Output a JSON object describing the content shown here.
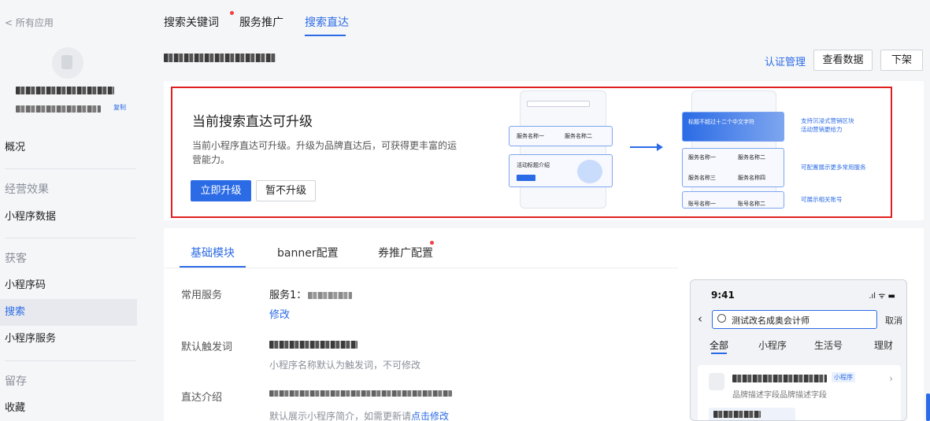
{
  "sidebar": {
    "back": "< 所有应用",
    "app_id_tag": "复制",
    "items": [
      {
        "label": "概况"
      },
      {
        "label": "经营效果"
      },
      {
        "label": "小程序数据"
      },
      {
        "label": "获客"
      },
      {
        "label": "小程序码"
      },
      {
        "label": "搜索"
      },
      {
        "label": "小程序服务"
      },
      {
        "label": "留存"
      },
      {
        "label": "收藏"
      }
    ]
  },
  "topnav": {
    "tabs": [
      "搜索关键词",
      "服务推广",
      "搜索直达"
    ],
    "active": "搜索直达"
  },
  "header": {
    "cert_link": "认证管理",
    "view_data": "查看数据",
    "offline": "下架"
  },
  "upgrade": {
    "title": "当前搜索直达可升级",
    "desc": "当前小程序直达可升级。升级为品牌直达后，可获得更丰富的运营能力。",
    "primary": "立即升级",
    "secondary": "暂不升级",
    "illustration": {
      "left_card_title1": "服务名称一",
      "left_card_title2": "服务名称二",
      "left_promo": "活动标题介绍",
      "right_banner": "标题不超过十二个中文字符",
      "right_services": [
        "服务名称一",
        "服务名称二",
        "服务名称三",
        "服务名称四"
      ],
      "right_accounts": [
        "账号名称一",
        "账号名称二"
      ],
      "notes": [
        "支持沉浸式营销区块",
        "活动营销更给力",
        "可配置展示更多常用服务",
        "可展示相关账号"
      ]
    }
  },
  "content": {
    "tabs": [
      "基础模块",
      "banner配置",
      "券推广配置"
    ],
    "active_tab": "基础模块",
    "rows": [
      {
        "label": "常用服务",
        "value": "服务1：",
        "link": "修改"
      },
      {
        "label": "默认触发词",
        "hint": "小程序名称默认为触发词，不可修改"
      },
      {
        "label": "直达介绍",
        "hint": "默认展示小程序简介，如需更新请",
        "hint_link": "点击修改"
      }
    ]
  },
  "phone": {
    "time": "9:41",
    "status": ".ıl ᯤ ▬",
    "query": "测试改名成奥会计师",
    "cancel": "取消",
    "tabs": [
      "全部",
      "小程序",
      "生活号",
      "理财"
    ],
    "card_tag": "小程序",
    "card_desc": "品牌描述字段品牌描述字段"
  },
  "colors": {
    "accent": "#2b6be6",
    "highlight_border": "#e02020"
  }
}
